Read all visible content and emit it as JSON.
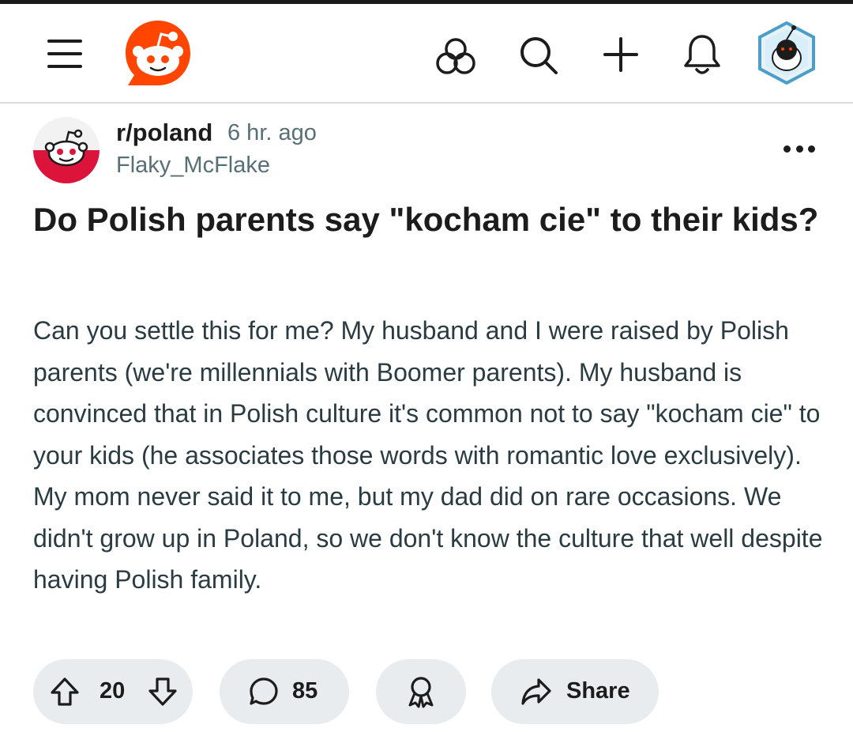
{
  "post": {
    "subreddit": "r/poland",
    "time": "6 hr. ago",
    "author": "Flaky_McFlake",
    "title": "Do Polish parents say \"kocham cie\" to their kids?",
    "body": "Can you settle this for me? My husband and I were raised by Polish parents (we're millennials with Boomer parents). My husband is convinced that in Polish culture it's common not to say \"kocham cie\" to your kids (he associates those words with romantic love exclusively). My mom never said it to me, but my dad did on rare occasions. We didn't grow up in Poland, so we don't know the culture that well despite having Polish family."
  },
  "actions": {
    "votes": "20",
    "comments": "85",
    "share_label": "Share"
  },
  "icons": {
    "menu": "hamburger-menu-icon",
    "logo": "reddit-logo-icon",
    "communities": "communities-icon",
    "search": "search-icon",
    "create": "plus-icon",
    "notifications": "bell-icon",
    "avatar": "user-avatar",
    "more": "more-options-icon",
    "upvote": "upvote-arrow-icon",
    "downvote": "downvote-arrow-icon",
    "comment": "comment-bubble-icon",
    "award": "award-icon",
    "share": "share-arrow-icon"
  },
  "colors": {
    "brand": "#FF4500",
    "text": "#1C1C1C",
    "muted": "#576F76",
    "pill": "#E8ECEE"
  }
}
